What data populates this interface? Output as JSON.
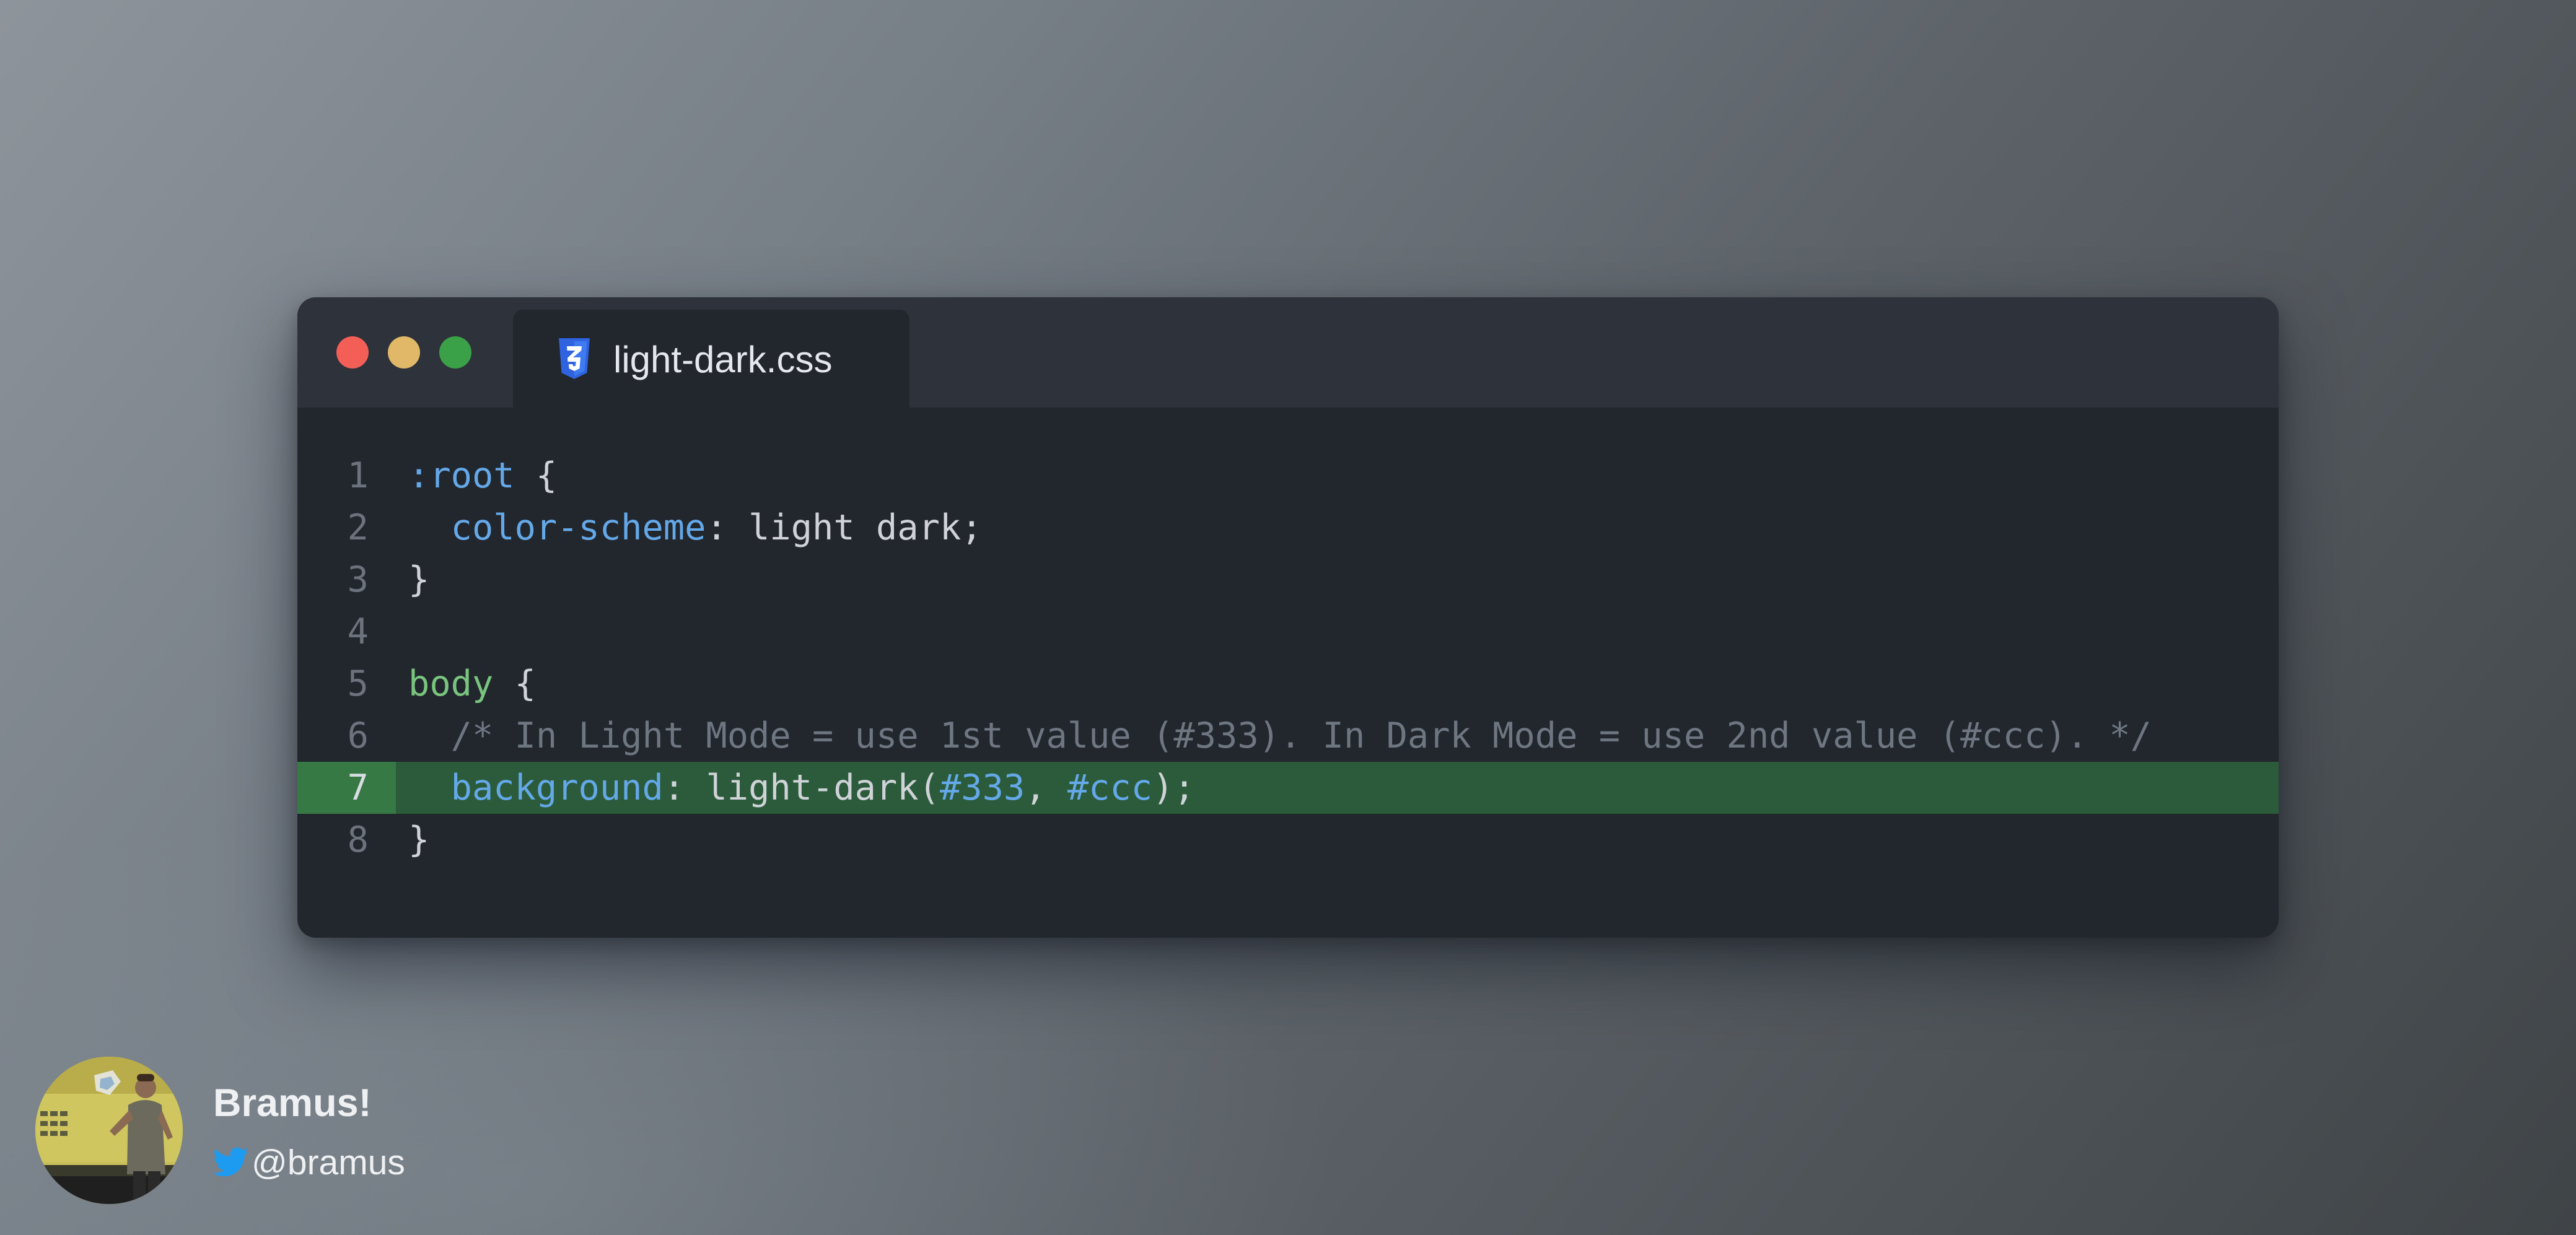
{
  "window": {
    "traffic_lights": [
      "close",
      "minimize",
      "maximize"
    ],
    "tab": {
      "icon": "css3-icon",
      "filename": "light-dark.css"
    }
  },
  "editor": {
    "language": "css",
    "highlighted_line": 7,
    "lines": [
      {
        "number": "1",
        "segments": [
          {
            "type": "selector",
            "text": ":root"
          },
          {
            "type": "punctuation",
            "text": " {"
          }
        ]
      },
      {
        "number": "2",
        "segments": [
          {
            "type": "punctuation",
            "text": "  "
          },
          {
            "type": "property",
            "text": "color-scheme"
          },
          {
            "type": "punctuation",
            "text": ": light dark;"
          }
        ]
      },
      {
        "number": "3",
        "segments": [
          {
            "type": "punctuation",
            "text": "}"
          }
        ]
      },
      {
        "number": "4",
        "segments": []
      },
      {
        "number": "5",
        "segments": [
          {
            "type": "tag",
            "text": "body"
          },
          {
            "type": "punctuation",
            "text": " {"
          }
        ]
      },
      {
        "number": "6",
        "segments": [
          {
            "type": "comment",
            "text": "  /* In Light Mode = use 1st value (#333). In Dark Mode = use 2nd value (#ccc). */"
          }
        ]
      },
      {
        "number": "7",
        "segments": [
          {
            "type": "punctuation",
            "text": "  "
          },
          {
            "type": "property",
            "text": "background"
          },
          {
            "type": "punctuation",
            "text": ": light-dark("
          },
          {
            "type": "hex",
            "text": "#333"
          },
          {
            "type": "punctuation",
            "text": ", "
          },
          {
            "type": "hex",
            "text": "#ccc"
          },
          {
            "type": "punctuation",
            "text": ");"
          }
        ]
      },
      {
        "number": "8",
        "segments": [
          {
            "type": "punctuation",
            "text": "}"
          }
        ]
      }
    ]
  },
  "author": {
    "name": "Bramus!",
    "handle": "@bramus",
    "handle_icon": "twitter-icon",
    "avatar": "avatar-photo"
  },
  "colors": {
    "close": "#f35f57",
    "minimize": "#e0b868",
    "maximize": "#3aa149",
    "highlight_line": "#2b5b3a",
    "highlight_gutter": "#367945",
    "css3_blue": "#2f63e0",
    "twitter_blue": "#1d9bf0"
  }
}
